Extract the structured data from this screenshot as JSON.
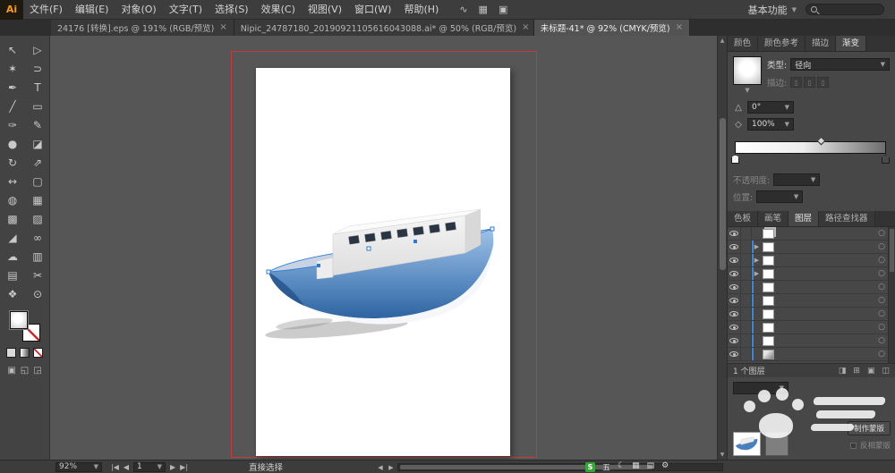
{
  "colors": {
    "accent": "#3f86cf",
    "artboard_outline": "#c23c3c",
    "hull_blue": "#3a6fae"
  },
  "icons": {
    "caret_down": "▼",
    "target_circle": "○",
    "expand_arrow": "▶",
    "scroll_left": "◀",
    "scroll_right": "▶",
    "scroll_up": "▲",
    "scroll_down": "▼"
  },
  "menubar": {
    "logo": "Ai",
    "items": [
      "文件(F)",
      "编辑(E)",
      "对象(O)",
      "文字(T)",
      "选择(S)",
      "效果(C)",
      "视图(V)",
      "窗口(W)",
      "帮助(H)"
    ],
    "icons": [
      {
        "name": "wave-icon",
        "glyph": "∿"
      },
      {
        "name": "arrange-documents-icon",
        "glyph": "▦"
      },
      {
        "name": "share-screen-icon",
        "glyph": "▣"
      }
    ],
    "workspace_label": "基本功能"
  },
  "tabbar": {
    "tabs": [
      {
        "label": "24176 [转换].eps @ 191% (RGB/预览)",
        "close": "×",
        "active": false
      },
      {
        "label": "Nipic_24787180_20190921105616043088.ai* @ 50% (RGB/预览)",
        "close": "×",
        "active": false
      },
      {
        "label": "未标题-41* @ 92% (CMYK/预览)",
        "close": "×",
        "active": true
      }
    ]
  },
  "toolbar": {
    "tools": [
      {
        "name": "selection-tool",
        "glyph": "↖"
      },
      {
        "name": "direct-selection-tool",
        "glyph": "▷"
      },
      {
        "name": "magic-wand-tool",
        "glyph": "✶"
      },
      {
        "name": "lasso-tool",
        "glyph": "⊃"
      },
      {
        "name": "pen-tool",
        "glyph": "✒"
      },
      {
        "name": "type-tool",
        "glyph": "T"
      },
      {
        "name": "line-segment-tool",
        "glyph": "╱"
      },
      {
        "name": "rectangle-tool",
        "glyph": "▭"
      },
      {
        "name": "paintbrush-tool",
        "glyph": "✑"
      },
      {
        "name": "pencil-tool",
        "glyph": "✎"
      },
      {
        "name": "blob-brush-tool",
        "glyph": "●"
      },
      {
        "name": "eraser-tool",
        "glyph": "◪"
      },
      {
        "name": "rotate-tool",
        "glyph": "↻"
      },
      {
        "name": "scale-tool",
        "glyph": "⇗"
      },
      {
        "name": "width-tool",
        "glyph": "↔"
      },
      {
        "name": "free-transform-tool",
        "glyph": "▢"
      },
      {
        "name": "shape-builder-tool",
        "glyph": "◍"
      },
      {
        "name": "perspective-grid-tool",
        "glyph": "▦"
      },
      {
        "name": "mesh-tool",
        "glyph": "▩"
      },
      {
        "name": "gradient-tool",
        "glyph": "▨"
      },
      {
        "name": "eyedropper-tool",
        "glyph": "◢"
      },
      {
        "name": "blend-tool",
        "glyph": "∞"
      },
      {
        "name": "symbol-sprayer-tool",
        "glyph": "☁"
      },
      {
        "name": "column-graph-tool",
        "glyph": "▥"
      },
      {
        "name": "artboard-tool",
        "glyph": "▤"
      },
      {
        "name": "slice-tool",
        "glyph": "✂"
      },
      {
        "name": "hand-tool",
        "glyph": "❖"
      },
      {
        "name": "zoom-tool",
        "glyph": "⊙"
      }
    ],
    "modes": [
      {
        "name": "draw-normal-mode",
        "glyph": "▣"
      },
      {
        "name": "draw-behind-mode",
        "glyph": "◱"
      },
      {
        "name": "draw-inside-mode",
        "glyph": "◲"
      }
    ]
  },
  "panels": {
    "gradient": {
      "tabs": [
        {
          "label": "颜色",
          "active": false
        },
        {
          "label": "颜色参考",
          "active": false
        },
        {
          "label": "描边",
          "active": false
        },
        {
          "label": "渐变",
          "active": true
        }
      ],
      "type_label": "类型:",
      "type_value": "径向",
      "stroke_label": "描边:",
      "angle_glyph": "△",
      "angle_value": "0°",
      "ratio_glyph": "◇",
      "ratio_value": "100%",
      "opacity_label": "不透明度:",
      "location_label": "位置:"
    },
    "layers": {
      "tabs": [
        {
          "label": "色板",
          "active": false
        },
        {
          "label": "画笔",
          "active": false
        },
        {
          "label": "图层",
          "active": true
        },
        {
          "label": "路径查找器",
          "active": false
        }
      ],
      "rows": [
        {
          "arrow": false,
          "selected": false,
          "thumb": "stack"
        },
        {
          "arrow": true,
          "selected": true,
          "thumb": "plain"
        },
        {
          "arrow": true,
          "selected": true,
          "thumb": "plain"
        },
        {
          "arrow": true,
          "selected": true,
          "thumb": "plain"
        },
        {
          "arrow": false,
          "selected": true,
          "thumb": "plain"
        },
        {
          "arrow": false,
          "selected": true,
          "thumb": "plain"
        },
        {
          "arrow": false,
          "selected": true,
          "thumb": "plain"
        },
        {
          "arrow": false,
          "selected": true,
          "thumb": "plain"
        },
        {
          "arrow": false,
          "selected": true,
          "thumb": "plain"
        },
        {
          "arrow": false,
          "selected": true,
          "thumb": "shadow"
        }
      ],
      "footer_label": "1 个图层",
      "footer_icons": [
        {
          "name": "make-clip-mask-icon",
          "glyph": "◨"
        },
        {
          "name": "new-sublayer-icon",
          "glyph": "⊞"
        },
        {
          "name": "new-layer-icon",
          "glyph": "▣"
        },
        {
          "name": "delete-layer-icon",
          "glyph": "◫"
        }
      ]
    },
    "transparency": {
      "make_mask_label": "制作蒙版",
      "invert_mask_label": "反相蒙版"
    }
  },
  "statusbar": {
    "zoom": "92%",
    "nav_first": "|◀",
    "nav_prev": "◀",
    "artboard_value": "1",
    "nav_next": "▶",
    "nav_last": "▶|",
    "tool_label": "直接选择"
  },
  "ime": {
    "brand": "S",
    "items": [
      {
        "name": "wubi-mode-icon",
        "glyph": "五"
      },
      {
        "name": "moon-icon",
        "glyph": "☾"
      },
      {
        "name": "grid-icon",
        "glyph": "▦"
      },
      {
        "name": "keyboard-icon",
        "glyph": "▤"
      },
      {
        "name": "toolbox-icon",
        "glyph": "⚙"
      }
    ]
  }
}
